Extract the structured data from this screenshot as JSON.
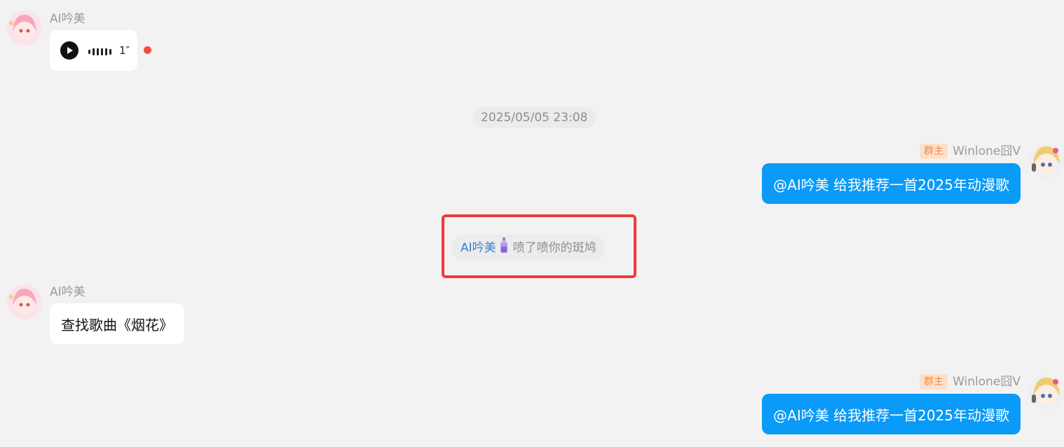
{
  "messages": [
    {
      "sender": "AI吟美",
      "voice": {
        "duration": "1″",
        "unread": true
      }
    },
    {
      "timestamp": "2025/05/05 23:08"
    },
    {
      "sender": "Winlone囧V",
      "badge": "群主",
      "text": "@AI吟美 给我推荐一首2025年动漫歌"
    },
    {
      "system": {
        "user": "AI吟美",
        "icon": "perfume-bottle-icon",
        "text": "喷了喷你的斑鸠"
      }
    },
    {
      "sender": "AI吟美",
      "text": "查找歌曲《烟花》"
    },
    {
      "sender": "Winlone囧V",
      "badge": "群主",
      "text": "@AI吟美 给我推荐一首2025年动漫歌"
    }
  ],
  "colors": {
    "background": "#f2f2f2",
    "outgoing_bubble": "#0a9af7",
    "incoming_bubble": "#ffffff",
    "highlight": "#ee3a3a",
    "mention_user": "#3b7fd6"
  }
}
